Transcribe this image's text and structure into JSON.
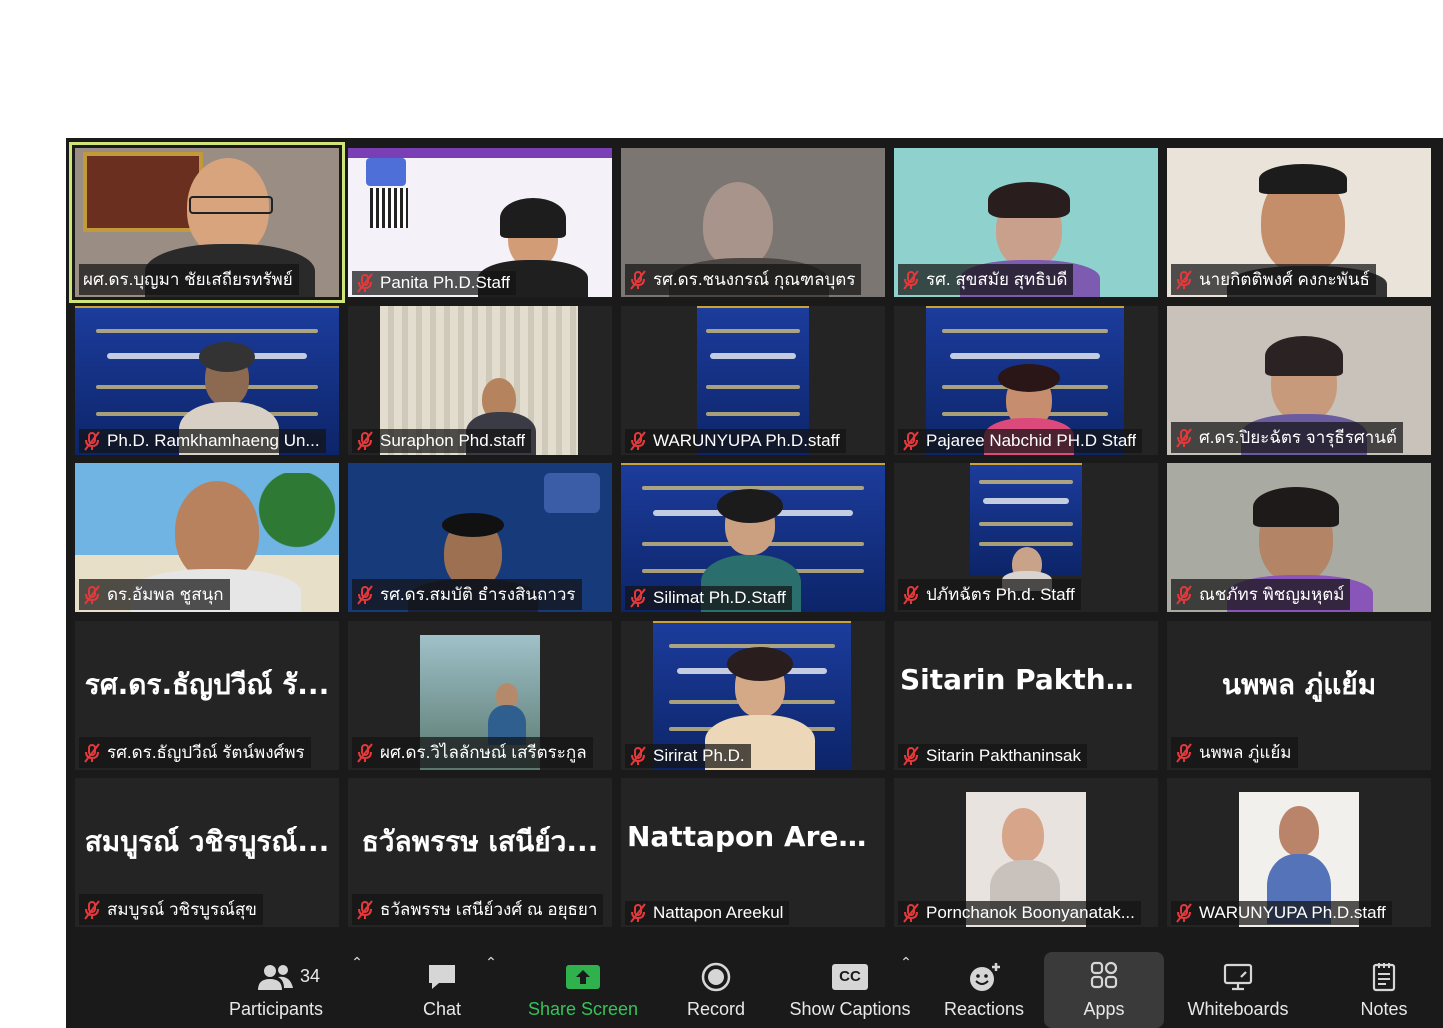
{
  "participants_grid": [
    {
      "name": "ผศ.ดร.บุญมา  ชัยเสถียรทรัพย์",
      "muted": false,
      "speaker": true,
      "feed": "man-office"
    },
    {
      "name": "Panita Ph.D.Staff",
      "muted": true,
      "feed": "poster-woman"
    },
    {
      "name": "รศ.ดร.ชนงกรณ์  กุณฑลบุตร",
      "muted": true,
      "feed": "man-blur"
    },
    {
      "name": "รศ. สุขสมัย สุทธิบดี",
      "muted": true,
      "feed": "woman-teal"
    },
    {
      "name": "นายกิตติพงศ์  คงกะพันธ์",
      "muted": true,
      "feed": "man-room"
    },
    {
      "name": "Ph.D. Ramkhamhaeng Un...",
      "muted": true,
      "feed": "banner-man"
    },
    {
      "name": "Suraphon Phd.staff",
      "muted": true,
      "feed": "man-curtain"
    },
    {
      "name": "WARUNYUPA Ph.D.staff",
      "muted": true,
      "feed": "banner-small"
    },
    {
      "name": "Pajaree Nabchid PH.D Staff",
      "muted": true,
      "feed": "banner-woman"
    },
    {
      "name": "ศ.ดร.ปิยะฉัตร จารุธีรศานต์",
      "muted": true,
      "feed": "woman-glasses"
    },
    {
      "name": "ดร.อัมพล  ชูสนุก",
      "muted": true,
      "feed": "man-beach"
    },
    {
      "name": "รศ.ดร.สมบัติ  ธำรงสินถาวร",
      "muted": true,
      "feed": "man-blue"
    },
    {
      "name": "Silimat Ph.D.Staff",
      "muted": true,
      "feed": "banner-woman2"
    },
    {
      "name": "ปภัทฉัตร Ph.d. Staff",
      "muted": true,
      "feed": "banner-small2"
    },
    {
      "name": "ณชภัทร พิชญมหุตม์",
      "muted": true,
      "feed": "woman-purple"
    },
    {
      "name": "รศ.ดร.ธัญปวีณ์  รัตน์พงศ์พร",
      "muted": true,
      "display": "รศ.ดร.ธัญปวีณ์  รั...",
      "feed": "none"
    },
    {
      "name": "ผศ.ดร.วิไลลักษณ์  เสรีตระกูล",
      "muted": true,
      "feed": "photo-bridge"
    },
    {
      "name": "Sirirat Ph.D.",
      "muted": true,
      "feed": "banner-woman3"
    },
    {
      "name": "Sitarin Pakthaninsak",
      "muted": true,
      "display": "Sitarin  Pakthani...",
      "feed": "none"
    },
    {
      "name": "นพพล ภู่แย้ม",
      "muted": true,
      "display": "นพพล ภู่แย้ม",
      "feed": "none"
    },
    {
      "name": "สมบูรณ์ วชิรบูรณ์สุข",
      "muted": true,
      "display": "สมบูรณ์ วชิรบูรณ์...",
      "feed": "none"
    },
    {
      "name": "ธวัลพรรษ เสนีย์วงศ์ ณ อยุธยา",
      "muted": true,
      "display": "ธวัลพรรษ เสนีย์ว...",
      "feed": "none"
    },
    {
      "name": "Nattapon Areekul",
      "muted": true,
      "display": "Nattapon Areekul",
      "feed": "none"
    },
    {
      "name": "Pornchanok Boonyanatak...",
      "muted": true,
      "feed": "photo-woman"
    },
    {
      "name": "WARUNYUPA Ph.D.staff",
      "muted": true,
      "feed": "photo-woman2"
    }
  ],
  "toolbar": {
    "participants_label": "Participants",
    "participants_count": "34",
    "chat_label": "Chat",
    "share_label": "Share Screen",
    "record_label": "Record",
    "captions_label": "Show Captions",
    "captions_icon_text": "CC",
    "reactions_label": "Reactions",
    "apps_label": "Apps",
    "whiteboards_label": "Whiteboards",
    "notes_label": "Notes"
  },
  "colors": {
    "speaker_outline": "#cfe57a",
    "share_green": "#35c35a",
    "muted_red": "#e5383b",
    "toolbar_bg": "#1a1a1a"
  },
  "icons": [
    "mic-muted-icon",
    "participants-icon",
    "chat-icon",
    "share-screen-icon",
    "record-icon",
    "captions-icon",
    "reactions-icon",
    "apps-icon",
    "whiteboards-icon",
    "notes-icon",
    "caret-up-icon"
  ]
}
